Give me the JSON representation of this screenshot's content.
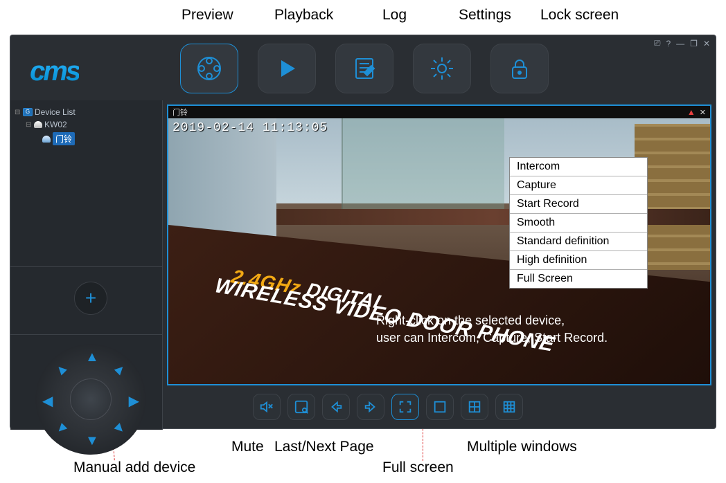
{
  "annotations": {
    "preview": "Preview",
    "playback": "Playback",
    "log": "Log",
    "settings": "Settings",
    "lock": "Lock screen",
    "mute": "Mute",
    "page": "Last/Next Page",
    "fullscreen_b": "Full screen",
    "multi": "Multiple windows",
    "manual_add": "Manual add device"
  },
  "app": {
    "logo": "cms",
    "window_controls": {
      "help": "?",
      "min": "—",
      "max": "❐",
      "close": "✕",
      "monitor": "⎚"
    }
  },
  "device_tree": {
    "root": "Device List",
    "group": "KW02",
    "camera": "门铃"
  },
  "viewport": {
    "title": "门铃",
    "timestamp": "2019-02-14  11:13:05",
    "box_text_top_pre": "2.4GHz ",
    "box_text_top_em": "DIGITAL",
    "box_text_bottom": "WIRELESS VIDEO DOOR PHONE",
    "close": "✕"
  },
  "context_menu": {
    "items": [
      "Intercom",
      "Capture",
      "Start Record",
      "Smooth",
      "Standard definition",
      "High definition",
      "Full Screen"
    ]
  },
  "overlay_note_l1": "Right-click on the selected device,",
  "overlay_note_l2": "user can Intercom, Capture, Start Record."
}
